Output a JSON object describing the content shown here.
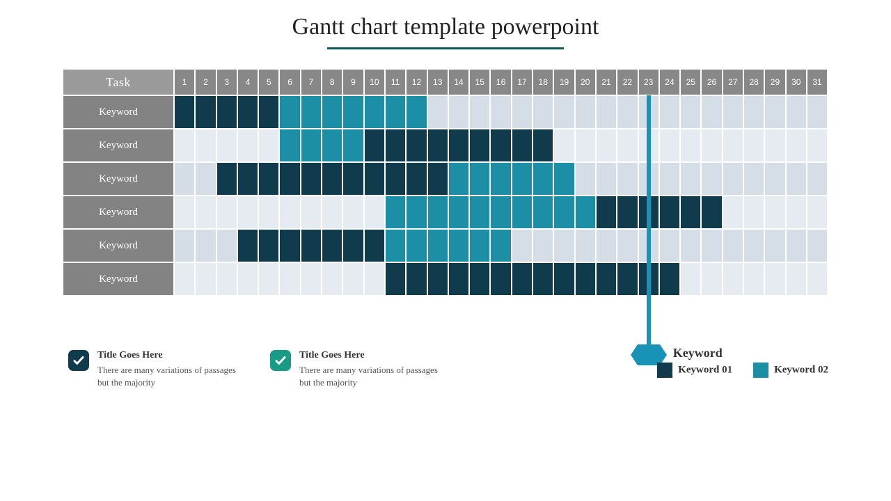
{
  "title": "Gantt chart template powerpoint",
  "chart_data": {
    "type": "bar",
    "title": "Gantt chart template powerpoint",
    "xlabel": "",
    "ylabel": "Task",
    "categories": [
      1,
      2,
      3,
      4,
      5,
      6,
      7,
      8,
      9,
      10,
      11,
      12,
      13,
      14,
      15,
      16,
      17,
      18,
      19,
      20,
      21,
      22,
      23,
      24,
      25,
      26,
      27,
      28,
      29,
      30,
      31
    ],
    "task_header": "Task",
    "rows": [
      {
        "label": "Keyword",
        "segments": [
          {
            "start": 1,
            "end": 5,
            "series": "Keyword 01"
          },
          {
            "start": 6,
            "end": 12,
            "series": "Keyword 02"
          }
        ]
      },
      {
        "label": "Keyword",
        "segments": [
          {
            "start": 6,
            "end": 9,
            "series": "Keyword 02"
          },
          {
            "start": 10,
            "end": 18,
            "series": "Keyword 01"
          }
        ]
      },
      {
        "label": "Keyword",
        "segments": [
          {
            "start": 3,
            "end": 13,
            "series": "Keyword 01"
          },
          {
            "start": 14,
            "end": 19,
            "series": "Keyword 02"
          }
        ]
      },
      {
        "label": "Keyword",
        "segments": [
          {
            "start": 11,
            "end": 20,
            "series": "Keyword 02"
          },
          {
            "start": 21,
            "end": 26,
            "series": "Keyword 01"
          }
        ]
      },
      {
        "label": "Keyword",
        "segments": [
          {
            "start": 4,
            "end": 10,
            "series": "Keyword 01"
          },
          {
            "start": 11,
            "end": 16,
            "series": "Keyword 02"
          }
        ]
      },
      {
        "label": "Keyword",
        "segments": [
          {
            "start": 11,
            "end": 24,
            "series": "Keyword 01"
          }
        ]
      }
    ],
    "series": [
      {
        "name": "Keyword 01",
        "color": "#103b4d"
      },
      {
        "name": "Keyword 02",
        "color": "#1c8ea6"
      }
    ],
    "marker": {
      "day": 23,
      "label": "Keyword",
      "color": "#1893b7"
    },
    "xlim": [
      1,
      31
    ]
  },
  "notes": [
    {
      "title": "Title Goes Here",
      "body": "There are many variations of passages but the majority",
      "color": "#103b4d"
    },
    {
      "title": "Title Goes Here",
      "body": "There are many variations of passages but the majority",
      "color": "#1a9b86"
    }
  ],
  "legend": {
    "k1": "Keyword 01",
    "k2": "Keyword 02"
  }
}
